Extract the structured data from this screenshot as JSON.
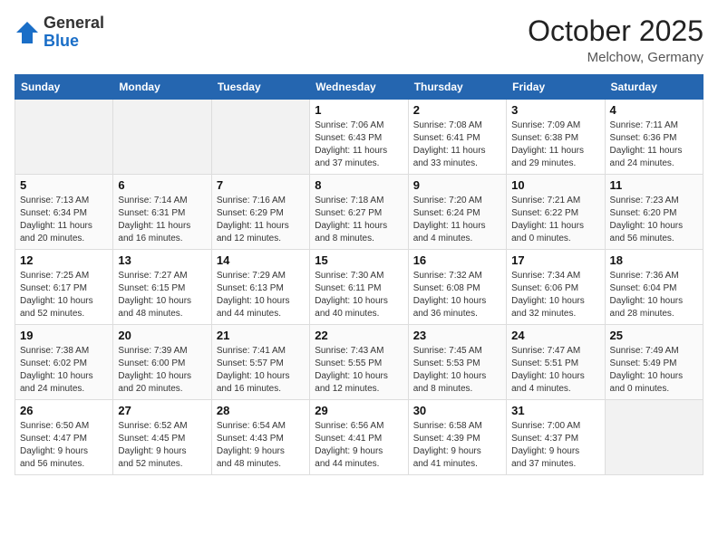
{
  "logo": {
    "general": "General",
    "blue": "Blue"
  },
  "header": {
    "month": "October 2025",
    "location": "Melchow, Germany"
  },
  "weekdays": [
    "Sunday",
    "Monday",
    "Tuesday",
    "Wednesday",
    "Thursday",
    "Friday",
    "Saturday"
  ],
  "weeks": [
    [
      {
        "day": "",
        "info": ""
      },
      {
        "day": "",
        "info": ""
      },
      {
        "day": "",
        "info": ""
      },
      {
        "day": "1",
        "info": "Sunrise: 7:06 AM\nSunset: 6:43 PM\nDaylight: 11 hours\nand 37 minutes."
      },
      {
        "day": "2",
        "info": "Sunrise: 7:08 AM\nSunset: 6:41 PM\nDaylight: 11 hours\nand 33 minutes."
      },
      {
        "day": "3",
        "info": "Sunrise: 7:09 AM\nSunset: 6:38 PM\nDaylight: 11 hours\nand 29 minutes."
      },
      {
        "day": "4",
        "info": "Sunrise: 7:11 AM\nSunset: 6:36 PM\nDaylight: 11 hours\nand 24 minutes."
      }
    ],
    [
      {
        "day": "5",
        "info": "Sunrise: 7:13 AM\nSunset: 6:34 PM\nDaylight: 11 hours\nand 20 minutes."
      },
      {
        "day": "6",
        "info": "Sunrise: 7:14 AM\nSunset: 6:31 PM\nDaylight: 11 hours\nand 16 minutes."
      },
      {
        "day": "7",
        "info": "Sunrise: 7:16 AM\nSunset: 6:29 PM\nDaylight: 11 hours\nand 12 minutes."
      },
      {
        "day": "8",
        "info": "Sunrise: 7:18 AM\nSunset: 6:27 PM\nDaylight: 11 hours\nand 8 minutes."
      },
      {
        "day": "9",
        "info": "Sunrise: 7:20 AM\nSunset: 6:24 PM\nDaylight: 11 hours\nand 4 minutes."
      },
      {
        "day": "10",
        "info": "Sunrise: 7:21 AM\nSunset: 6:22 PM\nDaylight: 11 hours\nand 0 minutes."
      },
      {
        "day": "11",
        "info": "Sunrise: 7:23 AM\nSunset: 6:20 PM\nDaylight: 10 hours\nand 56 minutes."
      }
    ],
    [
      {
        "day": "12",
        "info": "Sunrise: 7:25 AM\nSunset: 6:17 PM\nDaylight: 10 hours\nand 52 minutes."
      },
      {
        "day": "13",
        "info": "Sunrise: 7:27 AM\nSunset: 6:15 PM\nDaylight: 10 hours\nand 48 minutes."
      },
      {
        "day": "14",
        "info": "Sunrise: 7:29 AM\nSunset: 6:13 PM\nDaylight: 10 hours\nand 44 minutes."
      },
      {
        "day": "15",
        "info": "Sunrise: 7:30 AM\nSunset: 6:11 PM\nDaylight: 10 hours\nand 40 minutes."
      },
      {
        "day": "16",
        "info": "Sunrise: 7:32 AM\nSunset: 6:08 PM\nDaylight: 10 hours\nand 36 minutes."
      },
      {
        "day": "17",
        "info": "Sunrise: 7:34 AM\nSunset: 6:06 PM\nDaylight: 10 hours\nand 32 minutes."
      },
      {
        "day": "18",
        "info": "Sunrise: 7:36 AM\nSunset: 6:04 PM\nDaylight: 10 hours\nand 28 minutes."
      }
    ],
    [
      {
        "day": "19",
        "info": "Sunrise: 7:38 AM\nSunset: 6:02 PM\nDaylight: 10 hours\nand 24 minutes."
      },
      {
        "day": "20",
        "info": "Sunrise: 7:39 AM\nSunset: 6:00 PM\nDaylight: 10 hours\nand 20 minutes."
      },
      {
        "day": "21",
        "info": "Sunrise: 7:41 AM\nSunset: 5:57 PM\nDaylight: 10 hours\nand 16 minutes."
      },
      {
        "day": "22",
        "info": "Sunrise: 7:43 AM\nSunset: 5:55 PM\nDaylight: 10 hours\nand 12 minutes."
      },
      {
        "day": "23",
        "info": "Sunrise: 7:45 AM\nSunset: 5:53 PM\nDaylight: 10 hours\nand 8 minutes."
      },
      {
        "day": "24",
        "info": "Sunrise: 7:47 AM\nSunset: 5:51 PM\nDaylight: 10 hours\nand 4 minutes."
      },
      {
        "day": "25",
        "info": "Sunrise: 7:49 AM\nSunset: 5:49 PM\nDaylight: 10 hours\nand 0 minutes."
      }
    ],
    [
      {
        "day": "26",
        "info": "Sunrise: 6:50 AM\nSunset: 4:47 PM\nDaylight: 9 hours\nand 56 minutes."
      },
      {
        "day": "27",
        "info": "Sunrise: 6:52 AM\nSunset: 4:45 PM\nDaylight: 9 hours\nand 52 minutes."
      },
      {
        "day": "28",
        "info": "Sunrise: 6:54 AM\nSunset: 4:43 PM\nDaylight: 9 hours\nand 48 minutes."
      },
      {
        "day": "29",
        "info": "Sunrise: 6:56 AM\nSunset: 4:41 PM\nDaylight: 9 hours\nand 44 minutes."
      },
      {
        "day": "30",
        "info": "Sunrise: 6:58 AM\nSunset: 4:39 PM\nDaylight: 9 hours\nand 41 minutes."
      },
      {
        "day": "31",
        "info": "Sunrise: 7:00 AM\nSunset: 4:37 PM\nDaylight: 9 hours\nand 37 minutes."
      },
      {
        "day": "",
        "info": ""
      }
    ]
  ]
}
